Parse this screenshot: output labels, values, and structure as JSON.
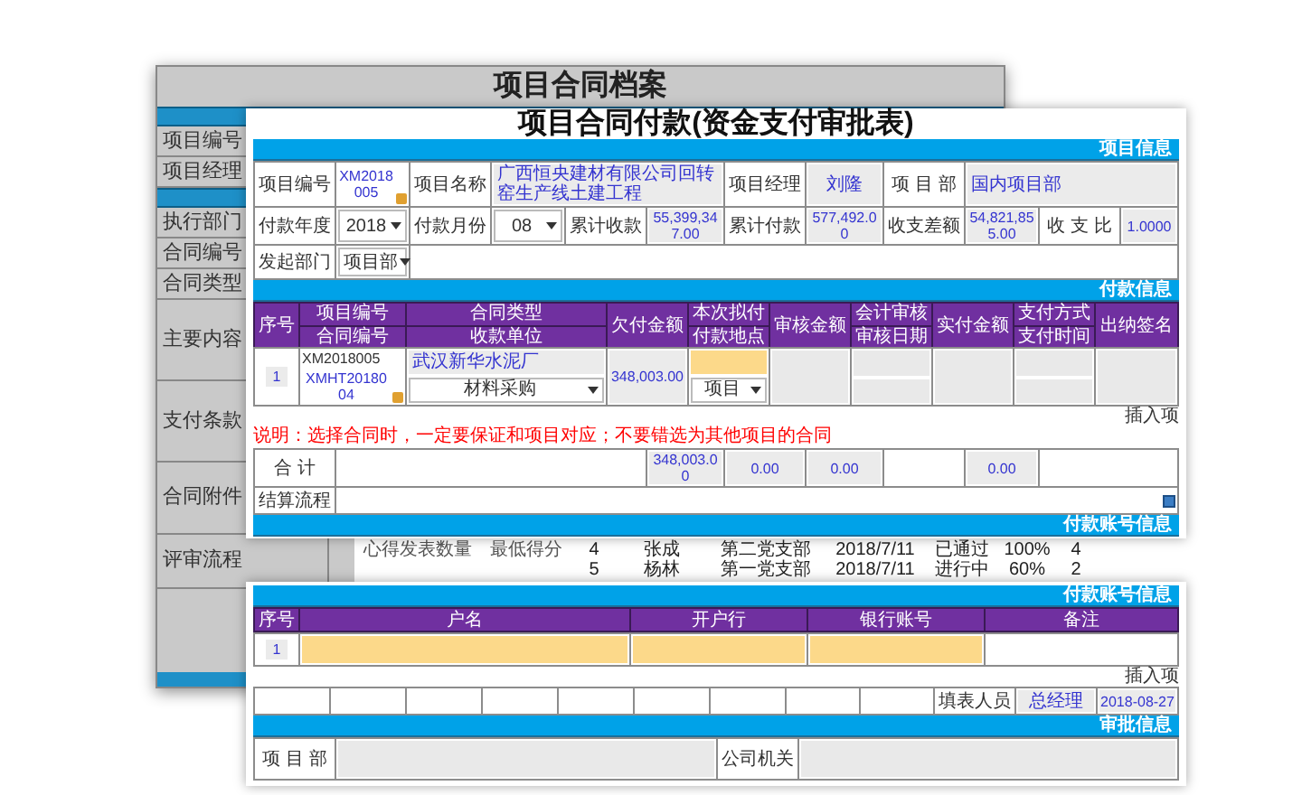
{
  "back_sheet": {
    "title": "项目合同档案",
    "labels": [
      "项目编号",
      "项目经理",
      "执行部门",
      "合同编号",
      "合同类型",
      "主要内容",
      "支付条款",
      "合同附件",
      "评审流程"
    ]
  },
  "back_table": {
    "labels": [
      "心得发表数量",
      "最低得分"
    ],
    "rows": [
      [
        "4",
        "张成",
        "第二党支部",
        "2018/7/11",
        "已通过",
        "100%",
        "4"
      ],
      [
        "5",
        "杨林",
        "第一党支部",
        "2018/7/11",
        "进行中",
        "60%",
        "2"
      ]
    ]
  },
  "form": {
    "title": "项目合同付款(资金支付审批表)",
    "project_info": {
      "header": "项目信息",
      "fields": [
        {
          "label": "项目编号",
          "kind": "lookup",
          "value": "XM2018005"
        },
        {
          "label": "项目名称",
          "kind": "name",
          "value": "广西恒央建材有限公司回转窑生产线土建工程"
        },
        {
          "label": "项目经理",
          "kind": "value",
          "value": "刘隆"
        },
        {
          "label": "项 目 部",
          "kind": "name",
          "value": "国内项目部"
        },
        {
          "label": "付款年度",
          "kind": "select",
          "value": "2018"
        },
        {
          "label": "付款月份",
          "kind": "select",
          "value": "08"
        },
        {
          "label": "累计收款",
          "kind": "amount",
          "value": "55,399,347.00"
        },
        {
          "label": "累计付款",
          "kind": "amount",
          "value": "577,492.00"
        },
        {
          "label": "收支差额",
          "kind": "amount",
          "value": "54,821,855.00"
        },
        {
          "label": "收 支 比",
          "kind": "amount",
          "value": "1.0000"
        },
        {
          "label": "发起部门",
          "kind": "select",
          "value": "项目部"
        }
      ]
    },
    "payment_info": {
      "header": "付款信息",
      "columns": [
        {
          "text": "序号"
        },
        {
          "text": "项目编号",
          "subtext": "合同编号"
        },
        {
          "text": "合同类型",
          "subtext": "收款单位"
        },
        {
          "text": "欠付金额"
        },
        {
          "text": "本次拟付",
          "subtext": "付款地点"
        },
        {
          "text": "审核金额"
        },
        {
          "text": "会计审核",
          "subtext": "审核日期"
        },
        {
          "text": "实付金额"
        },
        {
          "text": "支付方式",
          "subtext": "支付时间"
        },
        {
          "text": "出纳签名"
        }
      ],
      "rows": [
        [
          {
            "kind": "index",
            "text": "1"
          },
          {
            "kind": "stack",
            "parts": [
              {
                "kind": "text",
                "text": "XM2018005"
              },
              {
                "kind": "lookup",
                "text": "XMHT2018004"
              }
            ]
          },
          {
            "kind": "stack",
            "parts": [
              {
                "kind": "name",
                "text": "武汉新华水泥厂"
              },
              {
                "kind": "select",
                "text": "材料采购"
              }
            ]
          },
          {
            "kind": "amount",
            "text": "348,003.00"
          },
          {
            "kind": "stack",
            "parts": [
              {
                "kind": "field"
              },
              {
                "kind": "select",
                "text": "项目"
              }
            ]
          },
          {
            "kind": "gray"
          },
          {
            "kind": "stack",
            "parts": [
              {
                "kind": "gray"
              },
              {
                "kind": "gray"
              }
            ]
          },
          {
            "kind": "gray"
          },
          {
            "kind": "stack",
            "parts": [
              {
                "kind": "gray"
              },
              {
                "kind": "gray"
              }
            ]
          },
          {
            "kind": "gray"
          }
        ]
      ],
      "insert_label": "插入项",
      "note": "说明：选择合同时，一定要保证和项目对应；不要错选为其他项目的合同",
      "total_row": [
        {
          "kind": "label",
          "text": "合 计"
        },
        {
          "kind": "blank"
        },
        {
          "kind": "amount",
          "text": "348,003.00"
        },
        {
          "kind": "amount",
          "text": "0.00"
        },
        {
          "kind": "amount",
          "text": "0.00"
        },
        {
          "kind": "blank"
        },
        {
          "kind": "amount",
          "text": "0.00"
        },
        {
          "kind": "blank"
        }
      ],
      "settlement_row": [
        {
          "kind": "label",
          "text": "结算流程"
        },
        {
          "kind": "blank"
        }
      ]
    },
    "account_header": "付款账号信息"
  },
  "account_info": {
    "header": "付款账号信息",
    "columns": [
      "序号",
      "户名",
      "开户行",
      "银行账号",
      "备注"
    ],
    "rows": [
      [
        {
          "kind": "index",
          "text": "1"
        },
        {
          "kind": "field"
        },
        {
          "kind": "field"
        },
        {
          "kind": "field"
        },
        {
          "kind": "blank"
        }
      ]
    ],
    "insert_label": "插入项",
    "footer_row": [
      {
        "kind": "blank"
      },
      {
        "kind": "blank"
      },
      {
        "kind": "blank"
      },
      {
        "kind": "blank"
      },
      {
        "kind": "blank"
      },
      {
        "kind": "blank"
      },
      {
        "kind": "blank"
      },
      {
        "kind": "blank"
      },
      {
        "kind": "blank"
      },
      {
        "kind": "label",
        "text": "填表人员"
      },
      {
        "kind": "value",
        "text": "总经理"
      },
      {
        "kind": "amount",
        "text": "2018-08-27"
      }
    ]
  },
  "approval": {
    "header": "审批信息",
    "cells": [
      {
        "kind": "label",
        "text": "项 目 部"
      },
      {
        "kind": "gray"
      },
      {
        "kind": "label",
        "text": "公司机关"
      },
      {
        "kind": "gray"
      }
    ]
  }
}
